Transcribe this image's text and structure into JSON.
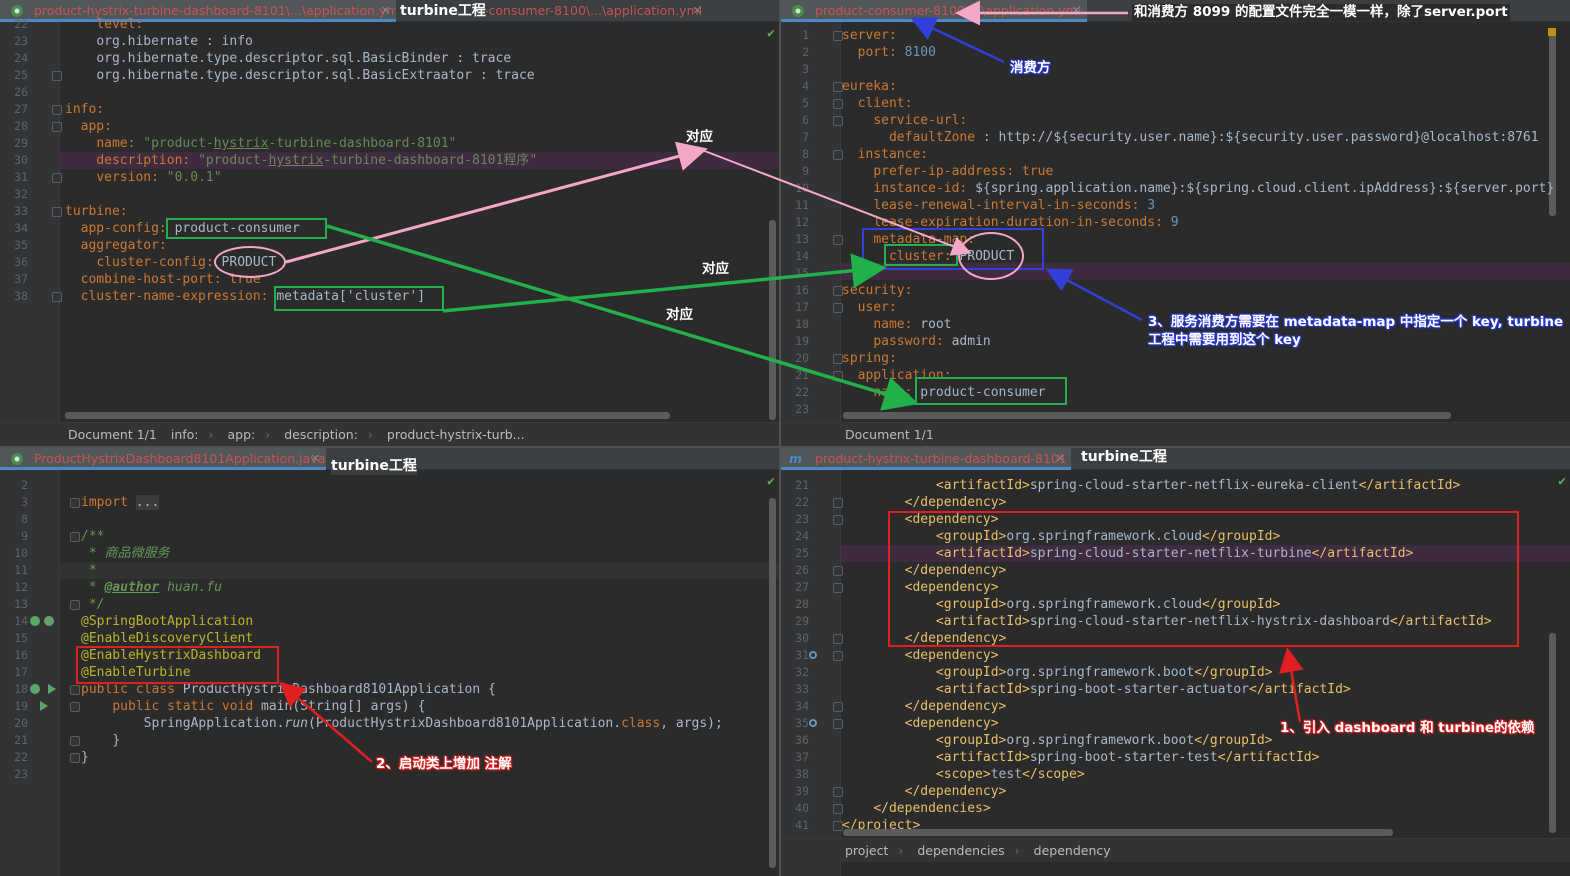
{
  "panes": {
    "top_left": {
      "tabs": [
        {
          "label": "product-hystrix-turbine-dashboard-8101\\...\\application.yml",
          "active": true
        },
        {
          "label": "-consumer-8100\\...\\application.yml",
          "active": false
        }
      ],
      "tab_overlay_label": "turbine工程",
      "breadcrumb": [
        "Document 1/1",
        "info:",
        "app:",
        "description:",
        "product-hystrix-turb..."
      ]
    },
    "top_right": {
      "tabs": [
        {
          "label": "product-consumer-8100\\...\\application.yml",
          "active": true
        }
      ],
      "breadcrumb": [
        "Document 1/1"
      ]
    },
    "bottom_left": {
      "tabs": [
        {
          "label": "ProductHystrixDashboard8101Application.java",
          "active": true
        }
      ],
      "tab_overlay_label": "turbine工程"
    },
    "bottom_right": {
      "tabs": [
        {
          "label": "product-hystrix-turbine-dashboard-8101",
          "active": true
        }
      ],
      "tab_overlay_label": "turbine工程",
      "breadcrumb": [
        "project",
        "dependencies",
        "dependency"
      ]
    }
  },
  "annotations": {
    "top_note": "和消费方 8099 的配置文件完全一模一样，除了server.port",
    "consumer_label": "消费方",
    "correspond_1": "对应",
    "correspond_2": "对应",
    "correspond_3": "对应",
    "note_3_line1": "3、服务消费方需要在 metadata-map 中指定一个 key, turbine",
    "note_3_line2": "工程中需要用到这个 key",
    "note_2": "2、启动类上增加 注解",
    "note_1": "1、引入 dashboard 和 turbine的依赖"
  },
  "colors": {
    "pink_arrow": "#f4a7c6",
    "green_box": "#22b04a",
    "blue_box": "#3040d8",
    "red_box": "#e02020",
    "tab_text": "#c75450"
  }
}
